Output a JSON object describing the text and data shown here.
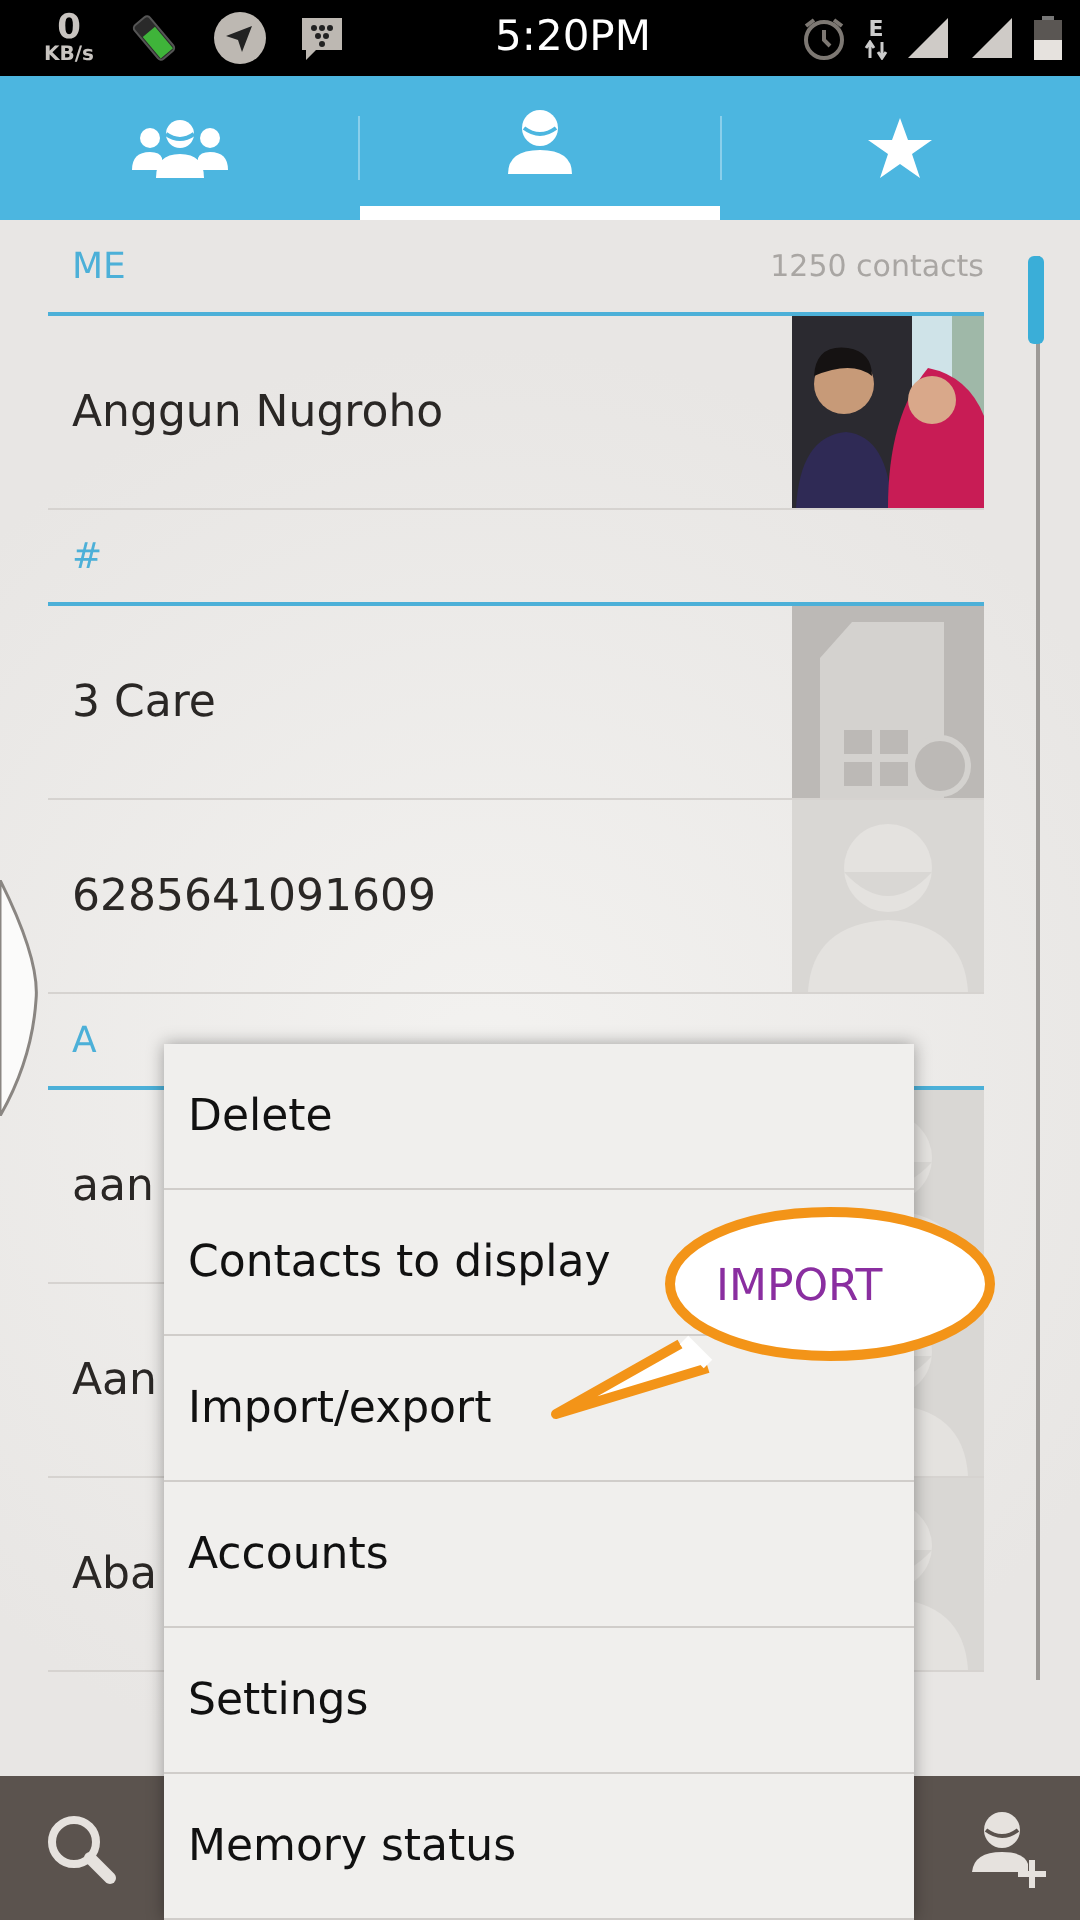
{
  "status_bar": {
    "net_speed_value": "0",
    "net_speed_unit": "KB/s",
    "time": "5:20PM",
    "network_type": "E"
  },
  "tabs": [
    {
      "kind": "groups",
      "selected": false
    },
    {
      "kind": "contacts",
      "selected": true
    },
    {
      "kind": "favorites",
      "selected": false
    }
  ],
  "sections": [
    {
      "header": "ME",
      "count": "1250 contacts",
      "contacts": [
        {
          "name": "Anggun Nugroho",
          "kind": "picture"
        }
      ]
    },
    {
      "header": "#",
      "contacts": [
        {
          "name": "3 Care",
          "kind": "sim"
        },
        {
          "name": "6285641091609",
          "kind": "default"
        }
      ]
    },
    {
      "header": "A",
      "contacts": [
        {
          "name": "aan",
          "kind": "default"
        },
        {
          "name": "Aan",
          "kind": "default"
        },
        {
          "name": "Aba",
          "kind": "default"
        }
      ]
    }
  ],
  "menu": {
    "items": [
      "Delete",
      "Contacts to display",
      "Import/export",
      "Accounts",
      "Settings",
      "Memory status"
    ]
  },
  "annotation": {
    "text": "IMPORT"
  }
}
